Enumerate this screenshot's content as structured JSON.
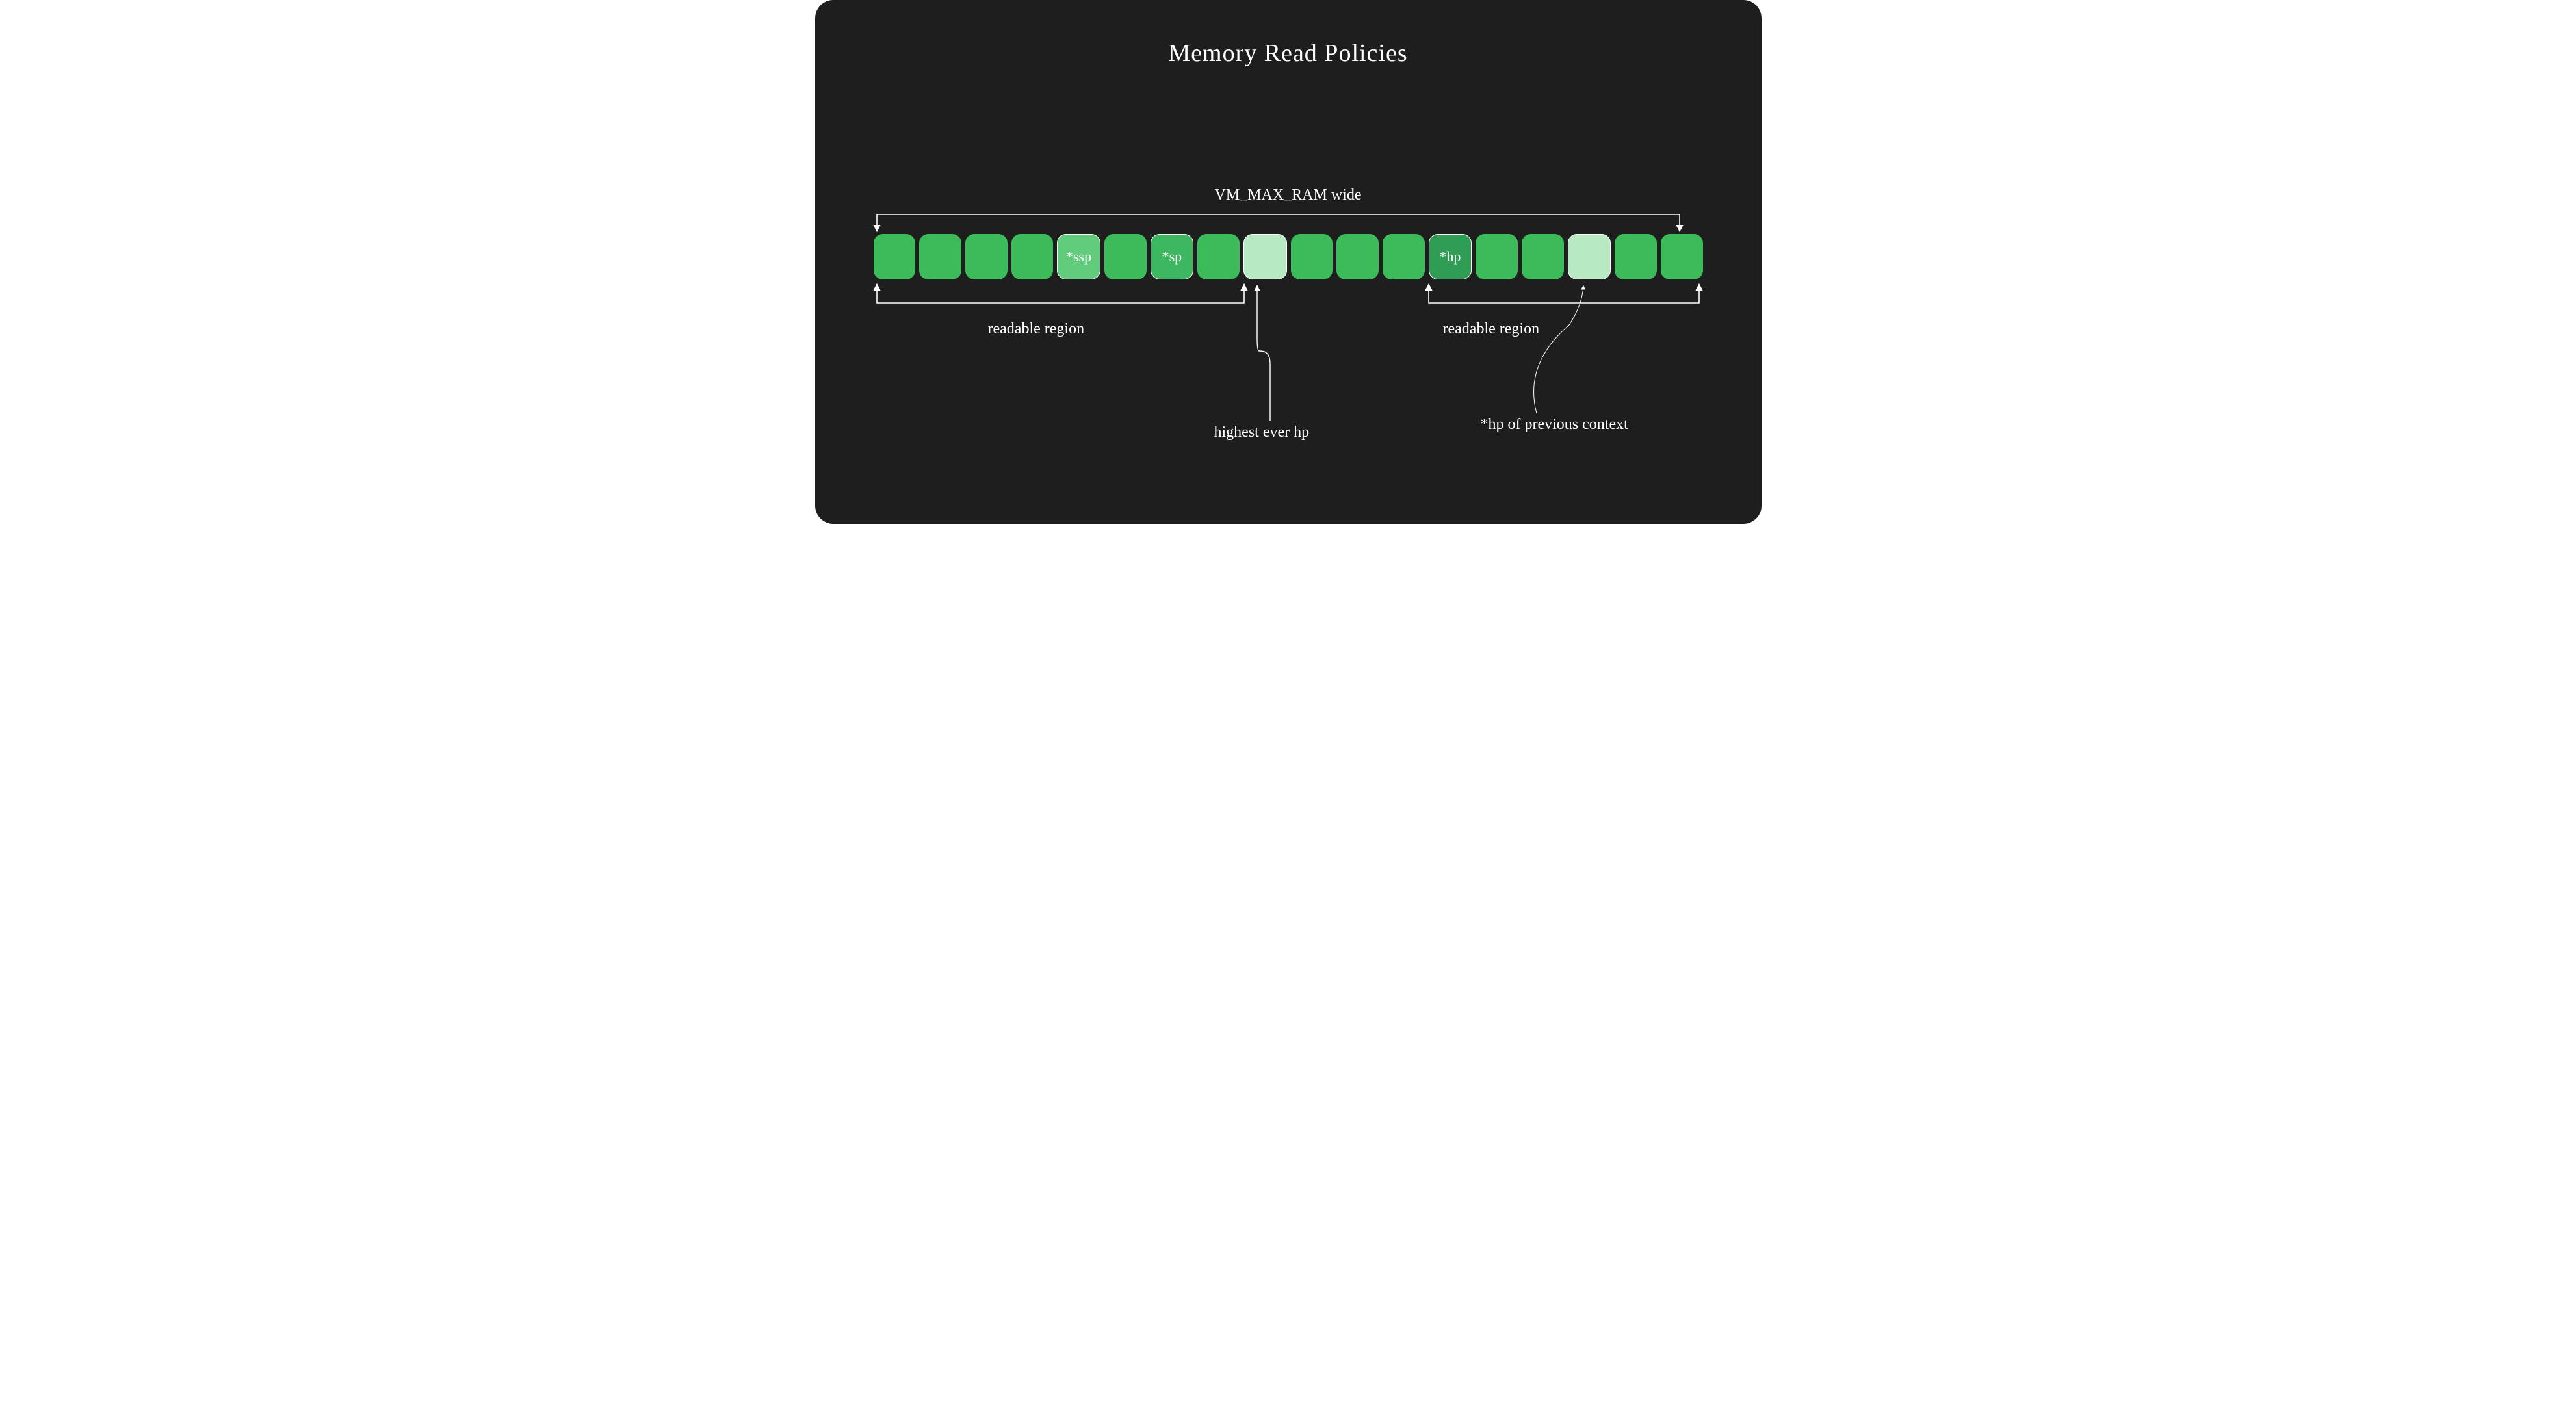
{
  "title": "Memory Read Policies",
  "top_span": "VM_MAX_RAM wide",
  "region1": "readable region",
  "region2": "readable region",
  "highest": "highest ever hp",
  "prev_ctx": "*hp of previous context",
  "cells": {
    "ssp": "*ssp",
    "sp": "*sp",
    "hp": "*hp"
  }
}
